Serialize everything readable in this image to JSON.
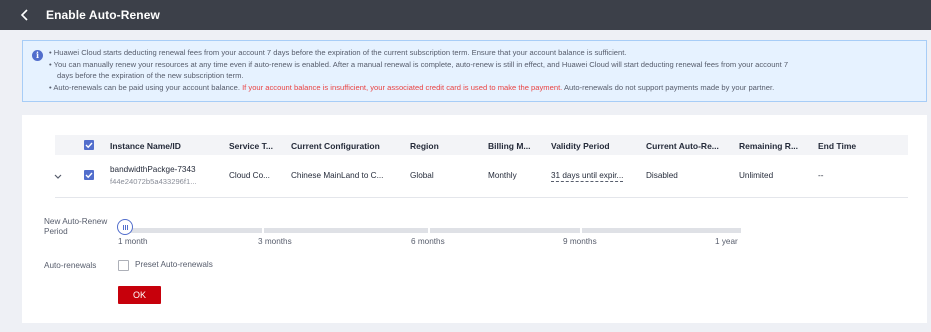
{
  "header": {
    "title": "Enable Auto-Renew",
    "back_icon": "chevron-left-icon"
  },
  "notice": {
    "icon": "info-icon",
    "lines": [
      "• Huawei Cloud starts deducting renewal fees from your account 7 days before the expiration of the current subscription term. Ensure that your account balance is sufficient.",
      "• You can manually renew your resources at any time even if auto-renew is enabled. After a manual renewal is complete, auto-renew is still in effect, and Huawei Cloud will start deducting renewal fees from your account 7",
      "days before the expiration of the new subscription term."
    ],
    "line4_prefix": "• Auto-renewals can be paid using your account balance. ",
    "line4_warning": "If your account balance is insufficient, your associated credit card is used to make the payment.",
    "line4_suffix": " Auto-renewals do not support payments made by your partner.",
    "warning_color": "#e94444"
  },
  "table": {
    "columns": [
      "Instance Name/ID",
      "Service T...",
      "Current Configuration",
      "Region",
      "Billing M...",
      "Validity Period",
      "Current Auto-Re...",
      "Remaining R...",
      "End Time"
    ],
    "rows": [
      {
        "name": "bandwidthPackge-7343",
        "id": "f44e24072b5a433296f1...",
        "service": "Cloud Co...",
        "configuration": "Chinese MainLand to C...",
        "region": "Global",
        "billing": "Monthly",
        "validity": "31 days until expir...",
        "auto_renew": "Disabled",
        "remaining": "Unlimited",
        "end_time": "--"
      }
    ]
  },
  "period": {
    "label": "New Auto-Renew Period",
    "ticks": [
      "1 month",
      "3 months",
      "6 months",
      "9 months",
      "1 year"
    ],
    "selected": "1 month"
  },
  "auto_renewals": {
    "label": "Auto-renewals",
    "option": "Preset Auto-renewals",
    "checked": false
  },
  "ok_label": "OK",
  "colors": {
    "header": "#3c4049",
    "accent": "#526ecc",
    "primary_button": "#c7000b",
    "notice_bg": "#e6f2ff"
  }
}
